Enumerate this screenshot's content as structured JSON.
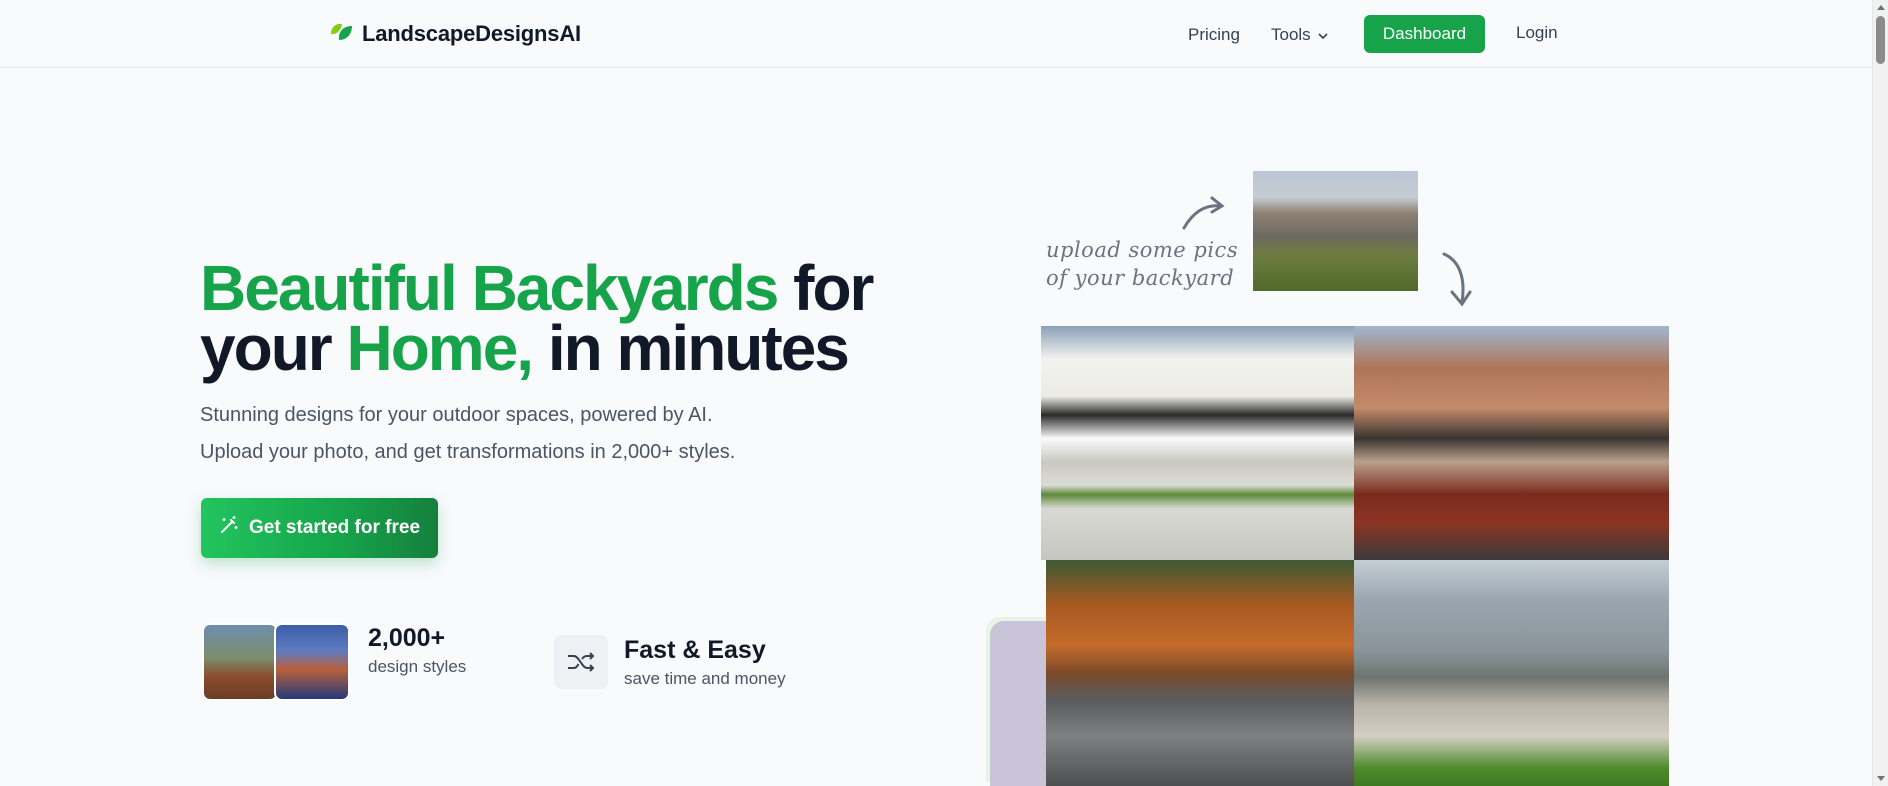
{
  "header": {
    "brand": "LandscapeDesignsAI",
    "nav": {
      "pricing": "Pricing",
      "tools": "Tools",
      "dashboard": "Dashboard",
      "login": "Login"
    }
  },
  "hero": {
    "headline": {
      "part1": "Beautiful Backyards",
      "part2": " for",
      "part3": "your ",
      "part4": "Home,",
      "part5": " in minutes"
    },
    "subtitle_line1": "Stunning designs for your outdoor spaces, powered by AI.",
    "subtitle_line2": "Upload your photo, and get transformations in 2,000+ styles.",
    "cta_label": "Get started for free"
  },
  "stats": {
    "styles_count": "2,000+",
    "styles_label": "design styles",
    "feature_title": "Fast & Easy",
    "feature_sub": "save time and money"
  },
  "visual": {
    "note_line1": "upload some pics",
    "note_line2": "of your backyard"
  },
  "colors": {
    "brand_green": "#16a34a",
    "text_dark": "#111827"
  },
  "icons": {
    "brand": "leaf-icon",
    "tools_chevron": "chevron-down-icon",
    "cta": "magic-wand-icon",
    "feature": "shuffle-icon"
  }
}
